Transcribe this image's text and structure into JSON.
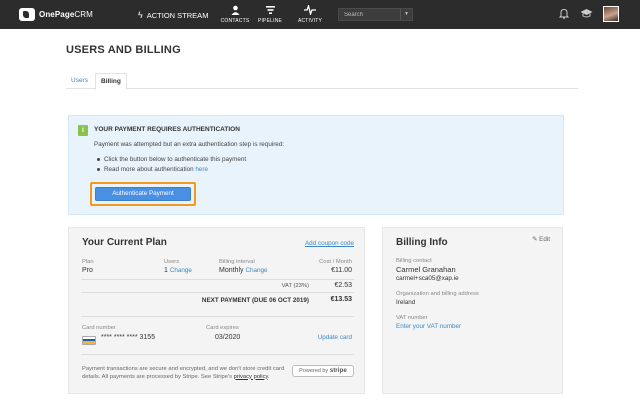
{
  "topbar": {
    "brand_bold": "OnePage",
    "brand_thin": "CRM",
    "action_stream": "ACTION STREAM",
    "nav": [
      {
        "label": "CONTACTS",
        "icon": "person-icon"
      },
      {
        "label": "PIPELINE",
        "icon": "filter-icon"
      },
      {
        "label": "ACTIVITY",
        "icon": "pulse-icon"
      }
    ],
    "search_placeholder": "Search"
  },
  "page": {
    "title": "USERS AND BILLING",
    "tabs": [
      {
        "label": "Users",
        "active": false
      },
      {
        "label": "Billing",
        "active": true
      }
    ]
  },
  "alert": {
    "title": "YOUR PAYMENT REQUIRES AUTHENTICATION",
    "body": "Payment was attempted but an extra authentication step is required:",
    "item1": "Click the button below to authenticate this payment",
    "item2_text": "Read more about authentication ",
    "item2_link": "here",
    "button": "Authenticate Payment",
    "icon_glyph": "i"
  },
  "plan": {
    "title": "Your Current Plan",
    "coupon": "Add coupon code",
    "plan_label": "Plan",
    "plan_value": "Pro",
    "users_label": "Users",
    "users_value": "1",
    "users_change": "Change",
    "interval_label": "Billing interval",
    "interval_value": "Monthly",
    "interval_change": "Change",
    "cost_label": "Cost / Month",
    "cost_value": "€11.00",
    "vat_label": "VAT (23%)",
    "vat_value": "€2.53",
    "next_label": "NEXT PAYMENT (DUE 06 OCT 2019)",
    "next_value": "€13.53",
    "card_label": "Card number",
    "card_value": "**** **** **** 3155",
    "expires_label": "Card expires",
    "expires_value": "03/2020",
    "update_card": "Update card",
    "fine_print": "Payment transactions are secure and encrypted, and we don't store credit card details. All payments are processed by Stripe. See Stripe's ",
    "fine_link": "privacy policy",
    "fine_end": ".",
    "stripe_prefix": "Powered by ",
    "stripe_brand": "stripe"
  },
  "billing": {
    "title": "Billing Info",
    "edit": "Edit",
    "contact_label": "Billing contact",
    "contact_name": "Carmel Granahan",
    "contact_email": "carmel+sca05@xap.ie",
    "org_label": "Organization and billing address",
    "org_value": "Ireland",
    "vat_label": "VAT number",
    "vat_link": "Enter your VAT number"
  },
  "colors": {
    "topbar": "#2c2c2c",
    "link": "#3b88c3",
    "alert_bg": "#e8f3fb",
    "button": "#4a90e2",
    "focus": "#f29a1f",
    "alert_icon": "#8bc34a"
  }
}
